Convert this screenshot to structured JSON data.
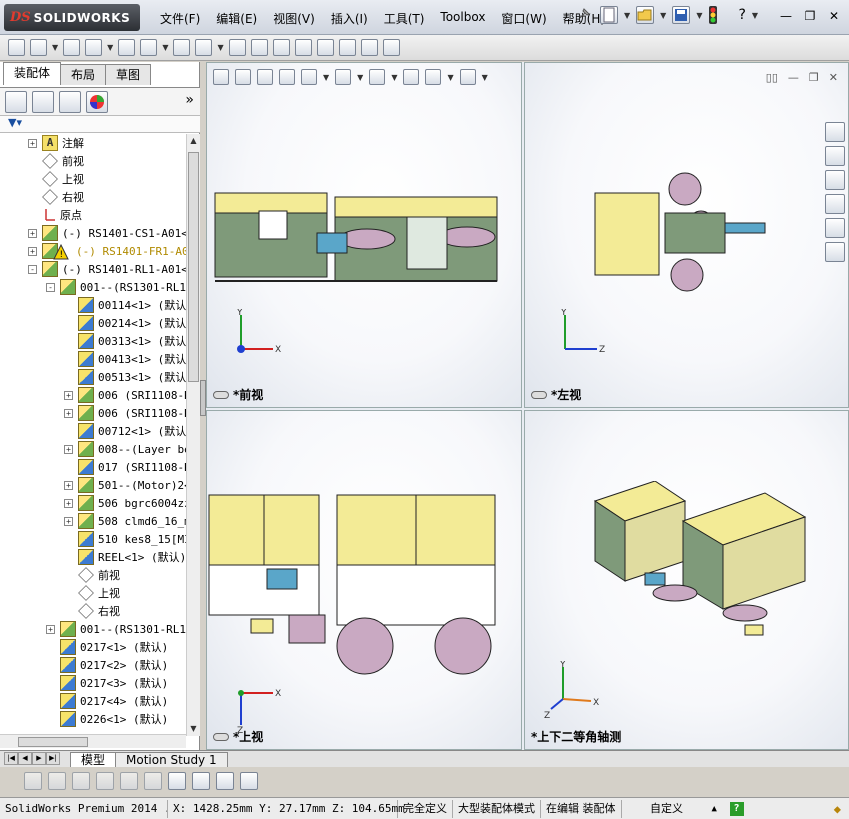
{
  "app": {
    "logo_prefix": "DS",
    "logo_name": "SOLIDWORKS"
  },
  "menu": [
    {
      "label": "文件(F)"
    },
    {
      "label": "编辑(E)"
    },
    {
      "label": "视图(V)"
    },
    {
      "label": "插入(I)"
    },
    {
      "label": "工具(T)"
    },
    {
      "label": "Toolbox"
    },
    {
      "label": "窗口(W)"
    },
    {
      "label": "帮助(H)"
    }
  ],
  "help_label": "?",
  "feature_tabs": [
    {
      "label": "装配体"
    },
    {
      "label": "布局"
    },
    {
      "label": "草图"
    }
  ],
  "tree": {
    "rows": [
      {
        "level": 0,
        "expander": "+",
        "icon": "note-icon",
        "text": "注解"
      },
      {
        "level": 0,
        "expander": "",
        "icon": "plane-icon",
        "text": "前视"
      },
      {
        "level": 0,
        "expander": "",
        "icon": "plane-icon",
        "text": "上视"
      },
      {
        "level": 0,
        "expander": "",
        "icon": "plane-icon",
        "text": "右视"
      },
      {
        "level": 0,
        "expander": "",
        "icon": "origin-icon",
        "text": "原点"
      },
      {
        "level": 0,
        "expander": "+",
        "icon": "subassembly-icon",
        "text": "(-) RS1401-CS1-A01<1"
      },
      {
        "level": 0,
        "expander": "+",
        "icon": "warning-subassembly-icon",
        "text": "(-) RS1401-FR1-A01",
        "warn": true
      },
      {
        "level": 0,
        "expander": "-",
        "icon": "subassembly-icon",
        "text": "(-) RS1401-RL1-A01<1"
      },
      {
        "level": 1,
        "expander": "-",
        "icon": "subassembly-icon",
        "text": "001--(RS1301-RL1-"
      },
      {
        "level": 2,
        "expander": "",
        "icon": "part-icon",
        "text": "00114<1> (默认"
      },
      {
        "level": 2,
        "expander": "",
        "icon": "part-icon",
        "text": "00214<1> (默认"
      },
      {
        "level": 2,
        "expander": "",
        "icon": "part-icon",
        "text": "00313<1> (默认"
      },
      {
        "level": 2,
        "expander": "",
        "icon": "part-icon",
        "text": "00413<1> (默认"
      },
      {
        "level": 2,
        "expander": "",
        "icon": "part-icon",
        "text": "00513<1> (默认"
      },
      {
        "level": 2,
        "expander": "+",
        "icon": "subassembly-icon",
        "text": "006 (SRI1108-R"
      },
      {
        "level": 2,
        "expander": "+",
        "icon": "subassembly-icon",
        "text": "006 (SRI1108-R"
      },
      {
        "level": 2,
        "expander": "",
        "icon": "part-icon",
        "text": "00712<1> (默认"
      },
      {
        "level": 2,
        "expander": "+",
        "icon": "subassembly-icon",
        "text": "008--(Layer be"
      },
      {
        "level": 2,
        "expander": "",
        "icon": "part-icon",
        "text": "017 (SRI1108-R"
      },
      {
        "level": 2,
        "expander": "+",
        "icon": "subassembly-icon",
        "text": "501--(Motor)2<"
      },
      {
        "level": 2,
        "expander": "+",
        "icon": "subassembly-icon",
        "text": "506 bgrc6004zz"
      },
      {
        "level": 2,
        "expander": "+",
        "icon": "subassembly-icon",
        "text": "508 clmd6_16_m"
      },
      {
        "level": 2,
        "expander": "",
        "icon": "part-icon",
        "text": "510 kes8_15[MI"
      },
      {
        "level": 2,
        "expander": "",
        "icon": "part-icon",
        "text": "REEL<1> (默认)"
      },
      {
        "level": 2,
        "expander": "",
        "icon": "plane-icon",
        "text": "前视"
      },
      {
        "level": 2,
        "expander": "",
        "icon": "plane-icon",
        "text": "上视"
      },
      {
        "level": 2,
        "expander": "",
        "icon": "plane-icon",
        "text": "右视"
      },
      {
        "level": 1,
        "expander": "+",
        "icon": "subassembly-icon",
        "text": "001--(RS1301-RL1-"
      },
      {
        "level": 1,
        "expander": "",
        "icon": "part-icon",
        "text": "0217<1> (默认)"
      },
      {
        "level": 1,
        "expander": "",
        "icon": "part-icon",
        "text": "0217<2> (默认)"
      },
      {
        "level": 1,
        "expander": "",
        "icon": "part-icon",
        "text": "0217<3> (默认)"
      },
      {
        "level": 1,
        "expander": "",
        "icon": "part-icon",
        "text": "0217<4> (默认)"
      },
      {
        "level": 1,
        "expander": "",
        "icon": "part-icon",
        "text": "0226<1> (默认)"
      }
    ]
  },
  "viewports": [
    {
      "id": "front",
      "label": "*前视",
      "axes": [
        "Y",
        "X"
      ]
    },
    {
      "id": "left",
      "label": "*左视",
      "axes": [
        "Y",
        "Z"
      ]
    },
    {
      "id": "top",
      "label": "*上视",
      "axes": [
        "X",
        "Z"
      ]
    },
    {
      "id": "iso",
      "label": "*上下二等角轴测",
      "axes": [
        "Y",
        "X",
        "Z"
      ]
    }
  ],
  "bottom_tabs": [
    {
      "label": "模型",
      "active": true
    },
    {
      "label": "Motion Study 1",
      "active": false
    }
  ],
  "status": {
    "product": "SolidWorks Premium 2014 ...",
    "coords": "X: 1428.25mm Y: 27.17mm Z: 104.65mm",
    "definition": "完全定义",
    "large_assembly": "大型装配体模式",
    "editing": "在编辑 装配体",
    "units": "自定义"
  },
  "colors": {
    "machine_yellow": "#f3eb96",
    "machine_green": "#7f9a7a",
    "reel_purple": "#c9a9c2",
    "axis_red": "#d22020",
    "axis_green": "#1f9d2a",
    "axis_blue": "#1f3fd0"
  }
}
